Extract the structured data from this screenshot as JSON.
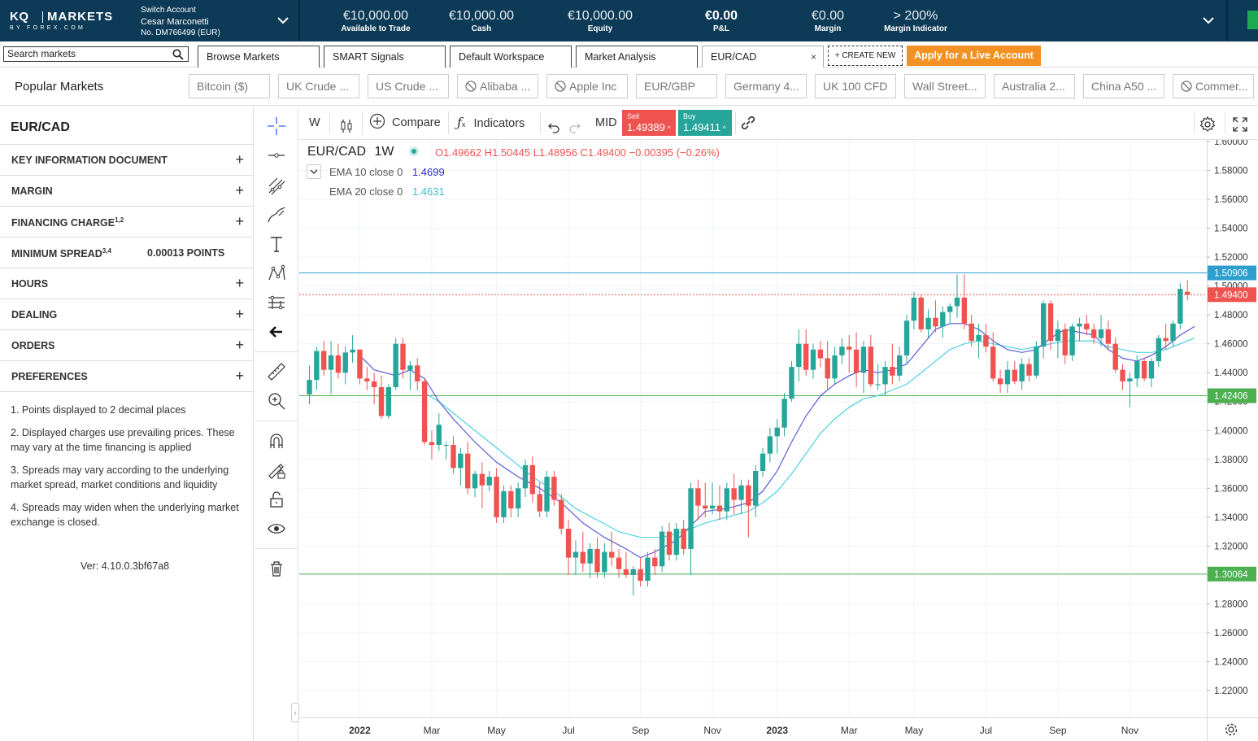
{
  "topbar": {
    "logo_kq": "KQ",
    "logo_markets": "MARKETS",
    "logo_by": "BY FOREX.COM",
    "switch_account_label": "Switch Account",
    "account_name": "Cesar Marconetti",
    "account_number": "No. DM766499 (EUR)",
    "metrics": [
      {
        "value": "€10,000.00",
        "label": "Available to Trade"
      },
      {
        "value": "€10,000.00",
        "label": "Cash"
      },
      {
        "value": "€10,000.00",
        "label": "Equity"
      },
      {
        "value": "€0.00",
        "label": "P&L"
      },
      {
        "value": "€0.00",
        "label": "Margin"
      },
      {
        "value": "> 200%",
        "label": "Margin Indicator"
      }
    ]
  },
  "tabs": {
    "search_placeholder": "Search markets",
    "items": [
      {
        "label": "Browse Markets"
      },
      {
        "label": "SMART Signals"
      },
      {
        "label": "Default Workspace"
      },
      {
        "label": "Market Analysis"
      },
      {
        "label": "EUR/CAD",
        "close": "×"
      }
    ],
    "create_new": "+ CREATE NEW",
    "apply_live": "Apply for a Live Account"
  },
  "popular_markets": {
    "title": "Popular Markets",
    "items": [
      {
        "label": "Bitcoin ($)",
        "blocked": false
      },
      {
        "label": "UK Crude ...",
        "blocked": false
      },
      {
        "label": "US Crude ...",
        "blocked": false
      },
      {
        "label": "Alibaba ...",
        "blocked": true
      },
      {
        "label": "Apple Inc",
        "blocked": true
      },
      {
        "label": "EUR/GBP",
        "blocked": false
      },
      {
        "label": "Germany 4...",
        "blocked": false
      },
      {
        "label": "UK 100 CFD",
        "blocked": false
      },
      {
        "label": "Wall Street...",
        "blocked": false
      },
      {
        "label": "Australia 2...",
        "blocked": false
      },
      {
        "label": "China A50 ...",
        "blocked": false
      },
      {
        "label": "Commer...",
        "blocked": true
      }
    ]
  },
  "info_panel": {
    "title": "EUR/CAD",
    "rows": [
      {
        "label": "KEY INFORMATION DOCUMENT",
        "sup": "",
        "value": "",
        "expand": "+"
      },
      {
        "label": "MARGIN",
        "sup": "",
        "value": "",
        "expand": "+"
      },
      {
        "label": "FINANCING CHARGE",
        "sup": "1,2",
        "value": "",
        "expand": "+"
      },
      {
        "label": "MINIMUM SPREAD",
        "sup": "3,4",
        "value": "0.00013 POINTS",
        "expand": ""
      },
      {
        "label": "HOURS",
        "sup": "",
        "value": "",
        "expand": "+"
      },
      {
        "label": "DEALING",
        "sup": "",
        "value": "",
        "expand": "+"
      },
      {
        "label": "ORDERS",
        "sup": "",
        "value": "",
        "expand": "+"
      },
      {
        "label": "PREFERENCES",
        "sup": "",
        "value": "",
        "expand": "+"
      }
    ],
    "notes": [
      "1. Points displayed to 2 decimal places",
      "2. Displayed charges use prevailing prices. These may vary at the time financing is applied",
      "3. Spreads may vary according to the underlying market spread, market conditions and liquidity",
      "4. Spreads may widen when the underlying market exchange is closed."
    ],
    "version": "Ver: 4.10.0.3bf67a8"
  },
  "chart_toolbar": {
    "interval": "W",
    "compare": "Compare",
    "indicators": "Indicators",
    "price_type": "MID",
    "sell_label": "Sell",
    "sell_price": "1.49389",
    "buy_label": "Buy",
    "buy_price": "1.49411"
  },
  "chart_legend": {
    "symbol": "EUR/CAD",
    "interval": "1W",
    "ohlc": "O1.49662  H1.50445  L1.48956  C1.49400  −0.00395 (−0.26%)",
    "ema10_label": "EMA 10 close 0",
    "ema10_value": "1.4699",
    "ema20_label": "EMA 20 close 0",
    "ema20_value": "1.4631"
  },
  "colors": {
    "up": "#26a69a",
    "down": "#ef5350",
    "ema10": "#5b5bd6",
    "ema20": "#4dd0e1",
    "level_cyan": "#2e9ecf",
    "level_green": "#4caf50",
    "topbar": "#0d3a56",
    "apply": "#f39223"
  },
  "chart_data": {
    "type": "candlestick",
    "title": "EUR/CAD 1W",
    "ylim": [
      1.2,
      1.6
    ],
    "y_ticks": [
      "1.60000",
      "1.58000",
      "1.56000",
      "1.54000",
      "1.52000",
      "1.50000",
      "1.48000",
      "1.46000",
      "1.44000",
      "1.42000",
      "1.40000",
      "1.38000",
      "1.36000",
      "1.34000",
      "1.32000",
      "1.30000",
      "1.28000",
      "1.26000",
      "1.24000",
      "1.22000"
    ],
    "x_ticks": [
      {
        "label": "2022",
        "bar": 7,
        "bold": true
      },
      {
        "label": "Mar",
        "bar": 17,
        "bold": false
      },
      {
        "label": "May",
        "bar": 26,
        "bold": false
      },
      {
        "label": "Jul",
        "bar": 36,
        "bold": false
      },
      {
        "label": "Sep",
        "bar": 46,
        "bold": false
      },
      {
        "label": "Nov",
        "bar": 56,
        "bold": false
      },
      {
        "label": "2023",
        "bar": 65,
        "bold": true
      },
      {
        "label": "Mar",
        "bar": 75,
        "bold": false
      },
      {
        "label": "May",
        "bar": 84,
        "bold": false
      },
      {
        "label": "Jul",
        "bar": 94,
        "bold": false
      },
      {
        "label": "Sep",
        "bar": 104,
        "bold": false
      },
      {
        "label": "Nov",
        "bar": 114,
        "bold": false
      }
    ],
    "horizontal_levels": [
      {
        "value": 1.50906,
        "label": "1.50906",
        "color": "cyan"
      },
      {
        "value": 1.494,
        "label": "1.49400",
        "color": "red_dotted"
      },
      {
        "value": 1.42406,
        "label": "1.42406",
        "color": "green"
      },
      {
        "value": 1.30064,
        "label": "1.30064",
        "color": "green"
      }
    ],
    "candles": [
      [
        1.425,
        1.445,
        1.418,
        1.435
      ],
      [
        1.435,
        1.458,
        1.428,
        1.455
      ],
      [
        1.455,
        1.462,
        1.438,
        1.442
      ],
      [
        1.442,
        1.462,
        1.425,
        1.452
      ],
      [
        1.452,
        1.46,
        1.436,
        1.44
      ],
      [
        1.44,
        1.458,
        1.432,
        1.454
      ],
      [
        1.454,
        1.466,
        1.447,
        1.456
      ],
      [
        1.456,
        1.456,
        1.432,
        1.436
      ],
      [
        1.436,
        1.444,
        1.428,
        1.434
      ],
      [
        1.434,
        1.44,
        1.418,
        1.43
      ],
      [
        1.43,
        1.438,
        1.408,
        1.41
      ],
      [
        1.41,
        1.432,
        1.408,
        1.43
      ],
      [
        1.43,
        1.464,
        1.428,
        1.46
      ],
      [
        1.46,
        1.464,
        1.436,
        1.442
      ],
      [
        1.442,
        1.448,
        1.428,
        1.445
      ],
      [
        1.445,
        1.45,
        1.428,
        1.434
      ],
      [
        1.434,
        1.436,
        1.39,
        1.392
      ],
      [
        1.392,
        1.4,
        1.38,
        1.39
      ],
      [
        1.39,
        1.412,
        1.386,
        1.404
      ],
      [
        1.39,
        1.392,
        1.38,
        1.39
      ],
      [
        1.39,
        1.396,
        1.37,
        1.374
      ],
      [
        1.374,
        1.388,
        1.362,
        1.384
      ],
      [
        1.384,
        1.392,
        1.356,
        1.36
      ],
      [
        1.36,
        1.372,
        1.354,
        1.37
      ],
      [
        1.37,
        1.378,
        1.346,
        1.362
      ],
      [
        1.362,
        1.372,
        1.358,
        1.368
      ],
      [
        1.368,
        1.374,
        1.336,
        1.34
      ],
      [
        1.34,
        1.362,
        1.336,
        1.358
      ],
      [
        1.358,
        1.362,
        1.34,
        1.346
      ],
      [
        1.346,
        1.364,
        1.34,
        1.36
      ],
      [
        1.36,
        1.38,
        1.354,
        1.376
      ],
      [
        1.376,
        1.382,
        1.35,
        1.356
      ],
      [
        1.356,
        1.364,
        1.34,
        1.344
      ],
      [
        1.344,
        1.372,
        1.34,
        1.368
      ],
      [
        1.368,
        1.372,
        1.348,
        1.352
      ],
      [
        1.352,
        1.356,
        1.328,
        1.332
      ],
      [
        1.332,
        1.338,
        1.3,
        1.312
      ],
      [
        1.312,
        1.324,
        1.3,
        1.316
      ],
      [
        1.316,
        1.33,
        1.302,
        1.308
      ],
      [
        1.308,
        1.322,
        1.298,
        1.318
      ],
      [
        1.318,
        1.326,
        1.298,
        1.302
      ],
      [
        1.302,
        1.322,
        1.298,
        1.316
      ],
      [
        1.316,
        1.33,
        1.306,
        1.312
      ],
      [
        1.312,
        1.318,
        1.298,
        1.304
      ],
      [
        1.304,
        1.316,
        1.298,
        1.3
      ],
      [
        1.3,
        1.306,
        1.286,
        1.304
      ],
      [
        1.304,
        1.312,
        1.292,
        1.296
      ],
      [
        1.296,
        1.316,
        1.292,
        1.312
      ],
      [
        1.312,
        1.318,
        1.3,
        1.306
      ],
      [
        1.306,
        1.334,
        1.302,
        1.33
      ],
      [
        1.33,
        1.336,
        1.31,
        1.314
      ],
      [
        1.314,
        1.336,
        1.31,
        1.332
      ],
      [
        1.332,
        1.338,
        1.314,
        1.318
      ],
      [
        1.318,
        1.364,
        1.3,
        1.36
      ],
      [
        1.36,
        1.366,
        1.338,
        1.348
      ],
      [
        1.348,
        1.364,
        1.34,
        1.346
      ],
      [
        1.346,
        1.364,
        1.342,
        1.348
      ],
      [
        1.348,
        1.362,
        1.338,
        1.344
      ],
      [
        1.344,
        1.364,
        1.338,
        1.36
      ],
      [
        1.36,
        1.37,
        1.342,
        1.352
      ],
      [
        1.352,
        1.366,
        1.342,
        1.362
      ],
      [
        1.362,
        1.366,
        1.326,
        1.348
      ],
      [
        1.348,
        1.376,
        1.34,
        1.372
      ],
      [
        1.372,
        1.388,
        1.368,
        1.384
      ],
      [
        1.384,
        1.402,
        1.378,
        1.396
      ],
      [
        1.396,
        1.408,
        1.384,
        1.402
      ],
      [
        1.402,
        1.426,
        1.396,
        1.422
      ],
      [
        1.422,
        1.448,
        1.42,
        1.444
      ],
      [
        1.444,
        1.47,
        1.434,
        1.46
      ],
      [
        1.46,
        1.47,
        1.438,
        1.442
      ],
      [
        1.442,
        1.46,
        1.436,
        1.456
      ],
      [
        1.456,
        1.462,
        1.444,
        1.45
      ],
      [
        1.45,
        1.462,
        1.428,
        1.436
      ],
      [
        1.436,
        1.458,
        1.432,
        1.452
      ],
      [
        1.452,
        1.464,
        1.446,
        1.458
      ],
      [
        1.458,
        1.466,
        1.44,
        1.456
      ],
      [
        1.456,
        1.468,
        1.43,
        1.44
      ],
      [
        1.44,
        1.462,
        1.426,
        1.458
      ],
      [
        1.458,
        1.466,
        1.43,
        1.432
      ],
      [
        1.432,
        1.446,
        1.428,
        1.432
      ],
      [
        1.432,
        1.448,
        1.424,
        1.444
      ],
      [
        1.444,
        1.46,
        1.432,
        1.438
      ],
      [
        1.438,
        1.458,
        1.434,
        1.452
      ],
      [
        1.452,
        1.48,
        1.446,
        1.476
      ],
      [
        1.476,
        1.496,
        1.47,
        1.492
      ],
      [
        1.492,
        1.494,
        1.468,
        1.47
      ],
      [
        1.47,
        1.484,
        1.464,
        1.478
      ],
      [
        1.478,
        1.49,
        1.468,
        1.472
      ],
      [
        1.472,
        1.486,
        1.464,
        1.482
      ],
      [
        1.482,
        1.488,
        1.474,
        1.486
      ],
      [
        1.486,
        1.508,
        1.478,
        1.492
      ],
      [
        1.492,
        1.508,
        1.47,
        1.474
      ],
      [
        1.474,
        1.48,
        1.458,
        1.462
      ],
      [
        1.462,
        1.474,
        1.45,
        1.466
      ],
      [
        1.466,
        1.474,
        1.454,
        1.458
      ],
      [
        1.458,
        1.468,
        1.434,
        1.436
      ],
      [
        1.436,
        1.442,
        1.426,
        1.432
      ],
      [
        1.432,
        1.448,
        1.426,
        1.442
      ],
      [
        1.442,
        1.448,
        1.432,
        1.434
      ],
      [
        1.434,
        1.45,
        1.428,
        1.446
      ],
      [
        1.446,
        1.45,
        1.434,
        1.438
      ],
      [
        1.438,
        1.462,
        1.436,
        1.458
      ],
      [
        1.458,
        1.49,
        1.45,
        1.488
      ],
      [
        1.488,
        1.49,
        1.456,
        1.462
      ],
      [
        1.462,
        1.476,
        1.45,
        1.47
      ],
      [
        1.47,
        1.474,
        1.446,
        1.452
      ],
      [
        1.452,
        1.474,
        1.448,
        1.472
      ],
      [
        1.472,
        1.478,
        1.462,
        1.474
      ],
      [
        1.474,
        1.48,
        1.466,
        1.47
      ],
      [
        1.47,
        1.474,
        1.46,
        1.464
      ],
      [
        1.464,
        1.48,
        1.458,
        1.47
      ],
      [
        1.47,
        1.476,
        1.456,
        1.46
      ],
      [
        1.46,
        1.464,
        1.44,
        1.442
      ],
      [
        1.442,
        1.446,
        1.428,
        1.434
      ],
      [
        1.434,
        1.44,
        1.416,
        1.436
      ],
      [
        1.436,
        1.452,
        1.43,
        1.448
      ],
      [
        1.448,
        1.45,
        1.434,
        1.436
      ],
      [
        1.436,
        1.45,
        1.43,
        1.448
      ],
      [
        1.448,
        1.466,
        1.444,
        1.464
      ],
      [
        1.464,
        1.474,
        1.456,
        1.462
      ],
      [
        1.462,
        1.476,
        1.458,
        1.474
      ],
      [
        1.474,
        1.502,
        1.47,
        1.498
      ],
      [
        1.496,
        1.504,
        1.49,
        1.494
      ]
    ],
    "ema10": [
      [
        7,
        1.452
      ],
      [
        9,
        1.442
      ],
      [
        12,
        1.438
      ],
      [
        14,
        1.442
      ],
      [
        16,
        1.436
      ],
      [
        18,
        1.42
      ],
      [
        20,
        1.408
      ],
      [
        23,
        1.392
      ],
      [
        26,
        1.378
      ],
      [
        29,
        1.368
      ],
      [
        32,
        1.36
      ],
      [
        35,
        1.35
      ],
      [
        38,
        1.336
      ],
      [
        41,
        1.326
      ],
      [
        44,
        1.318
      ],
      [
        46,
        1.312
      ],
      [
        48,
        1.316
      ],
      [
        51,
        1.324
      ],
      [
        53,
        1.334
      ],
      [
        55,
        1.344
      ],
      [
        58,
        1.346
      ],
      [
        61,
        1.35
      ],
      [
        63,
        1.358
      ],
      [
        65,
        1.372
      ],
      [
        67,
        1.392
      ],
      [
        69,
        1.41
      ],
      [
        71,
        1.424
      ],
      [
        73,
        1.432
      ],
      [
        75,
        1.438
      ],
      [
        77,
        1.442
      ],
      [
        79,
        1.44
      ],
      [
        81,
        1.442
      ],
      [
        83,
        1.446
      ],
      [
        85,
        1.458
      ],
      [
        87,
        1.47
      ],
      [
        89,
        1.474
      ],
      [
        91,
        1.474
      ],
      [
        93,
        1.47
      ],
      [
        95,
        1.462
      ],
      [
        97,
        1.456
      ],
      [
        99,
        1.454
      ],
      [
        101,
        1.456
      ],
      [
        103,
        1.464
      ],
      [
        105,
        1.47
      ],
      [
        107,
        1.468
      ],
      [
        109,
        1.466
      ],
      [
        111,
        1.456
      ],
      [
        113,
        1.45
      ],
      [
        115,
        1.448
      ],
      [
        117,
        1.452
      ],
      [
        119,
        1.458
      ],
      [
        121,
        1.466
      ],
      [
        123,
        1.472
      ]
    ],
    "ema20": [
      [
        16,
        1.426
      ],
      [
        18,
        1.42
      ],
      [
        20,
        1.412
      ],
      [
        22,
        1.404
      ],
      [
        25,
        1.392
      ],
      [
        28,
        1.38
      ],
      [
        31,
        1.368
      ],
      [
        34,
        1.358
      ],
      [
        37,
        1.346
      ],
      [
        40,
        1.338
      ],
      [
        43,
        1.33
      ],
      [
        46,
        1.326
      ],
      [
        49,
        1.326
      ],
      [
        52,
        1.33
      ],
      [
        55,
        1.336
      ],
      [
        58,
        1.34
      ],
      [
        61,
        1.344
      ],
      [
        63,
        1.35
      ],
      [
        65,
        1.358
      ],
      [
        67,
        1.37
      ],
      [
        69,
        1.384
      ],
      [
        71,
        1.398
      ],
      [
        73,
        1.408
      ],
      [
        75,
        1.416
      ],
      [
        77,
        1.422
      ],
      [
        79,
        1.424
      ],
      [
        81,
        1.428
      ],
      [
        83,
        1.432
      ],
      [
        85,
        1.44
      ],
      [
        87,
        1.448
      ],
      [
        89,
        1.456
      ],
      [
        91,
        1.46
      ],
      [
        93,
        1.462
      ],
      [
        95,
        1.46
      ],
      [
        97,
        1.458
      ],
      [
        99,
        1.456
      ],
      [
        101,
        1.458
      ],
      [
        103,
        1.46
      ],
      [
        105,
        1.462
      ],
      [
        107,
        1.462
      ],
      [
        109,
        1.462
      ],
      [
        111,
        1.458
      ],
      [
        113,
        1.456
      ],
      [
        115,
        1.454
      ],
      [
        117,
        1.454
      ],
      [
        119,
        1.456
      ],
      [
        121,
        1.46
      ],
      [
        123,
        1.464
      ]
    ]
  }
}
